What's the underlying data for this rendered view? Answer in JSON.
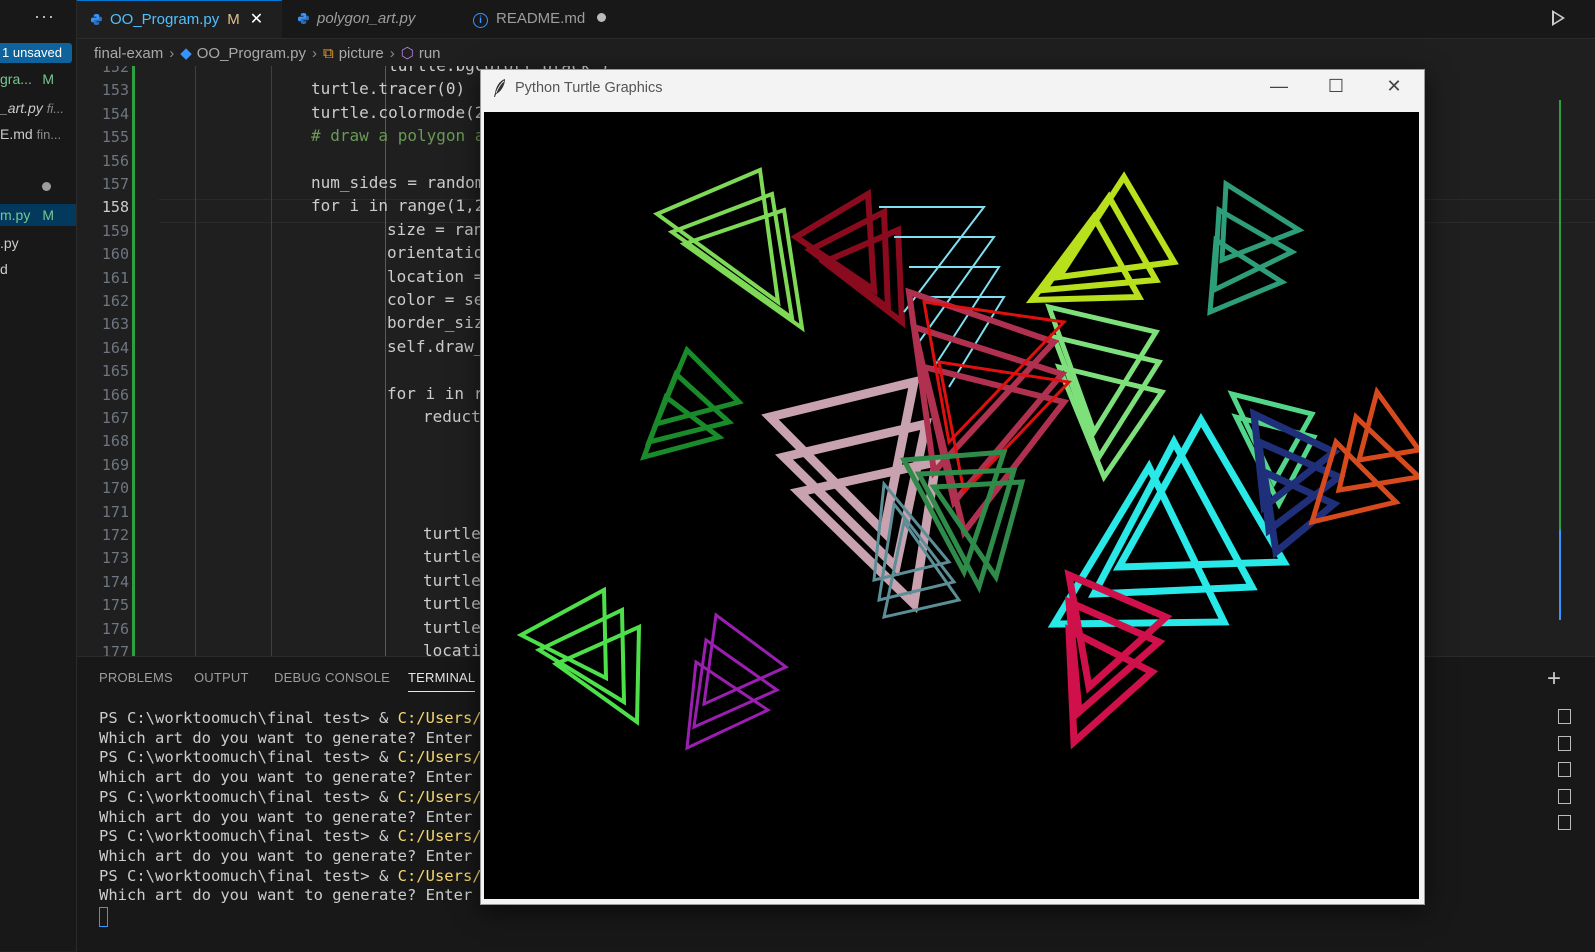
{
  "sidebar": {
    "more_label": "···",
    "unsaved_badge": "1 unsaved",
    "files": [
      {
        "label": "gra...",
        "suffix": "M"
      },
      {
        "label": "_art.py",
        "detail": "fi..."
      },
      {
        "label": "E.md",
        "detail": "fin..."
      },
      {
        "label": "m.py",
        "suffix": "M"
      },
      {
        "label": ".py"
      },
      {
        "label": "d"
      }
    ]
  },
  "tabs": [
    {
      "label": "OO_Program.py",
      "modified": "M",
      "close": "✕"
    },
    {
      "label": "polygon_art.py"
    },
    {
      "label": "README.md",
      "info": "i"
    }
  ],
  "breadcrumb": {
    "folder": "final-exam",
    "file": "OO_Program.py",
    "class": "picture",
    "method": "run"
  },
  "editor": {
    "lines": [
      {
        "n": "152",
        "html": "        turtle.bgcolor('black')"
      },
      {
        "n": "153",
        "text": "turtle.tracer(0)"
      },
      {
        "n": "154",
        "text": "turtle.colormode(2"
      },
      {
        "n": "155",
        "text": "# draw a polygon a"
      },
      {
        "n": "156",
        "text": ""
      },
      {
        "n": "157",
        "text": "num_sides = random"
      },
      {
        "n": "158",
        "text": "for i in range(1,2"
      },
      {
        "n": "159",
        "text": "size = ran"
      },
      {
        "n": "160",
        "text": "orientatio"
      },
      {
        "n": "161",
        "text": "location ="
      },
      {
        "n": "162",
        "text": "color = se"
      },
      {
        "n": "163",
        "text": "border_siz"
      },
      {
        "n": "164",
        "text": "self.draw_"
      },
      {
        "n": "165",
        "text": ""
      },
      {
        "n": "166",
        "text": "for i in r"
      },
      {
        "n": "167",
        "text": "reduct"
      },
      {
        "n": "168",
        "text": ""
      },
      {
        "n": "169",
        "text": ""
      },
      {
        "n": "170",
        "text": ""
      },
      {
        "n": "171",
        "text": ""
      },
      {
        "n": "172",
        "text": "turtle"
      },
      {
        "n": "173",
        "text": "turtle"
      },
      {
        "n": "174",
        "text": "turtle"
      },
      {
        "n": "175",
        "text": "turtle"
      },
      {
        "n": "176",
        "text": "turtle"
      },
      {
        "n": "177",
        "text": "locati"
      }
    ]
  },
  "panel": {
    "tabs": [
      "PROBLEMS",
      "OUTPUT",
      "DEBUG CONSOLE",
      "TERMINAL"
    ],
    "active_tab": "TERMINAL",
    "plus": "+",
    "terminal": {
      "prompt": "PS C:\\worktoomuch\\final test> & ",
      "path": "C:/Users/ac",
      "question": "Which art do you want to generate? Enter a"
    }
  },
  "turtle_window": {
    "title": "Python Turtle Graphics",
    "minimize": "—",
    "maximize": "☐",
    "close": "✕"
  },
  "colors": {
    "accent": "#0078d4",
    "canvas_bg": "#000000"
  }
}
